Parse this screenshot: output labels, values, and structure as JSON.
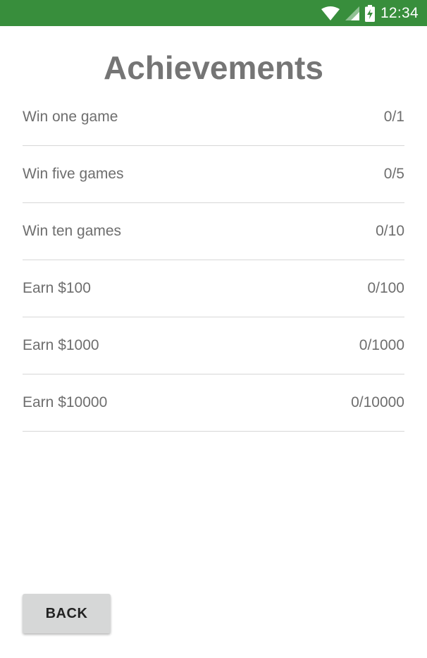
{
  "status_bar": {
    "time": "12:34",
    "background_color": "#388e3c",
    "icons": [
      "wifi-icon",
      "cell-signal-icon",
      "battery-charging-icon"
    ]
  },
  "page": {
    "title": "Achievements"
  },
  "achievements": [
    {
      "label": "Win one game",
      "progress": "0/1"
    },
    {
      "label": "Win five games",
      "progress": "0/5"
    },
    {
      "label": "Win ten games",
      "progress": "0/10"
    },
    {
      "label": "Earn $100",
      "progress": "0/100"
    },
    {
      "label": "Earn $1000",
      "progress": "0/1000"
    },
    {
      "label": "Earn $10000",
      "progress": "0/10000"
    }
  ],
  "footer": {
    "back_label": "BACK"
  }
}
